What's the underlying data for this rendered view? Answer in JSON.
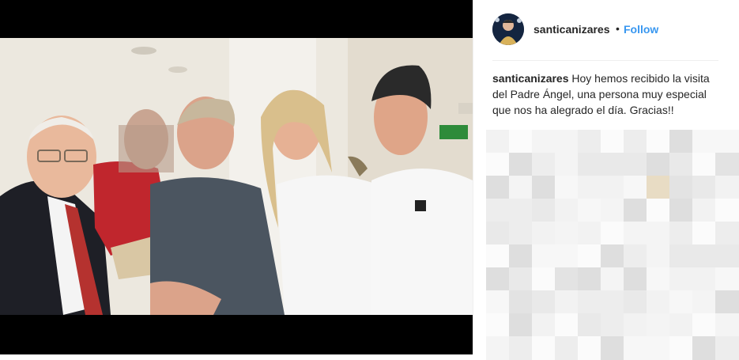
{
  "post": {
    "username": "santicanizares",
    "separator": "•",
    "follow_label": "Follow",
    "caption_username": "santicanizares",
    "caption_text": "Hoy hemos recibido la visita del Padre Ángel, una persona muy especial que nos ha alegrado el día. Gracias!!"
  },
  "photo": {
    "description_icon": "photo-of-five-people"
  },
  "colors": {
    "accent": "#3897f0",
    "text": "#262626",
    "divider": "#efefef"
  }
}
